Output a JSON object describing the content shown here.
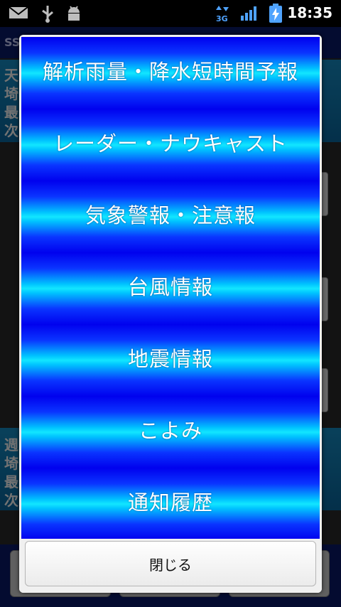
{
  "status_bar": {
    "time": "18:35",
    "network_label": "3G",
    "icons": [
      "mail-icon",
      "usb-icon",
      "android-debug-icon",
      "network-3g-icon",
      "signal-icon",
      "battery-charging-icon"
    ]
  },
  "background": {
    "title_fragment": "SS",
    "panel1_chars": [
      "天",
      "埼",
      "最",
      "次"
    ],
    "panel2_chars": [
      "週",
      "埼",
      "最",
      "次"
    ]
  },
  "dialog": {
    "menu_items": [
      "解析雨量・降水短時間予報",
      "レーダー・ナウキャスト",
      "気象警報・注意報",
      "台風情報",
      "地震情報",
      "こよみ",
      "通知履歴"
    ],
    "close_label": "閉じる"
  },
  "colors": {
    "menu_dark_blue": "#0000ee",
    "menu_cyan": "#12e6ff",
    "dialog_bg": "#f0f0f0"
  }
}
